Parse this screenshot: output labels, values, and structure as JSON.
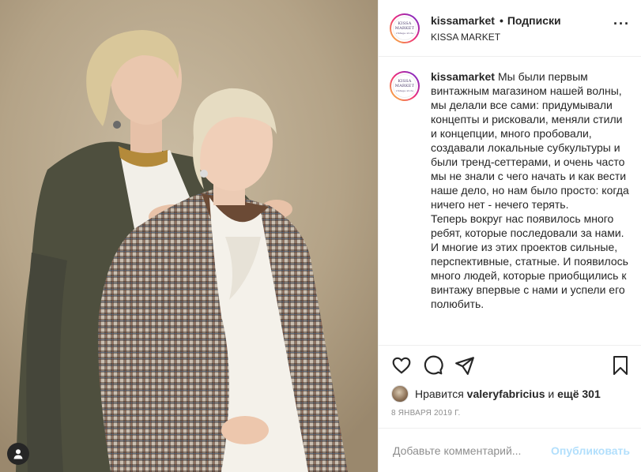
{
  "post": {
    "author": {
      "username": "kissamarket",
      "location": "KISSA MARKET",
      "avatar_logo_lines": [
        "KISSA",
        "MARKET",
        "vintage store"
      ]
    },
    "follow_separator": "•",
    "follow_label": "Подписки",
    "more_label": "···",
    "caption": {
      "username": "kissamarket",
      "paragraphs": [
        "Мы были первым винтажным магазином нашей волны, мы делали все сами: придумывали концепты и рисковали, меняли стили и концепции, много пробовали, создавали локальные субкультуры и были тренд-сеттерами, и очень часто мы не знали с чего начать и как вести наше дело, но нам было просто: когда ничего нет - нечего терять.",
        "Теперь вокруг нас появилось много ребят, которые последовали за нами. И многие из этих проектов сильные, перспективные, статные. И появилось много людей, которые приобщились к винтажу впервые с нами и успели его полюбить."
      ]
    },
    "likes": {
      "prefix": "Нравится",
      "user": "valeryfabricius",
      "conjunction": "и",
      "others": "ещё 301"
    },
    "date": "8 ЯНВАРЯ 2019 Г.",
    "comment": {
      "placeholder": "Добавьте комментарий...",
      "submit_label": "Опубликовать"
    },
    "colors": {
      "text": "#262626",
      "muted": "#8e8e8e",
      "border": "#efefef",
      "publish_disabled": "#b2dffc"
    },
    "icons": [
      "heart-icon",
      "comment-icon",
      "share-icon",
      "bookmark-icon",
      "user-tag-icon"
    ]
  }
}
